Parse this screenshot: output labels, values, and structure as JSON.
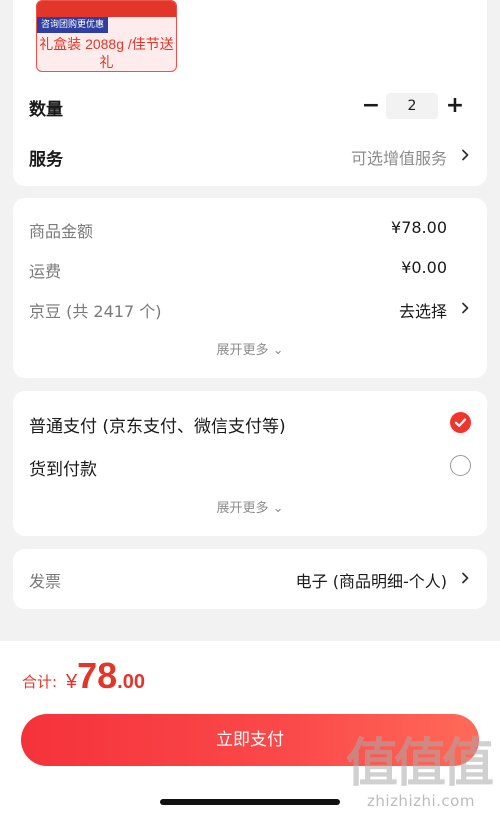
{
  "product": {
    "promo_text": "咨询团购更优惠",
    "sku_label": "礼盒装 2088g /佳节送礼"
  },
  "quantity": {
    "label": "数量",
    "minus": "−",
    "value": "2",
    "plus": "+"
  },
  "service": {
    "label": "服务",
    "value": "可选增值服务"
  },
  "amounts": {
    "goods_label": "商品金额",
    "goods_value": "¥78.00",
    "shipping_label": "运费",
    "shipping_value": "¥0.00",
    "jingdou_label": "京豆 (共 2417 个)",
    "jingdou_value": "去选择",
    "expand_more": "展开更多 ⌄"
  },
  "payment": {
    "option_1": "普通支付 (京东支付、微信支付等)",
    "option_1_selected": true,
    "option_2": "货到付款",
    "option_2_selected": false,
    "expand_more": "展开更多 ⌄"
  },
  "invoice": {
    "label": "发票",
    "value": "电子 (商品明细-个人)"
  },
  "footer": {
    "total_label": "合计:",
    "currency": "¥",
    "total_int": "78",
    "total_dec": ".00",
    "pay_button": "立即支付"
  },
  "watermark": {
    "mark": "值值值",
    "url": "zhizhizhi.com"
  },
  "colors": {
    "accent": "#e2362a",
    "button_start": "#f5323a",
    "button_end": "#ff6a58",
    "background": "#f2f2f2"
  },
  "icons": {
    "chevron": "chevron-right-icon",
    "check": "check-circle-icon",
    "radio": "radio-empty-icon"
  }
}
